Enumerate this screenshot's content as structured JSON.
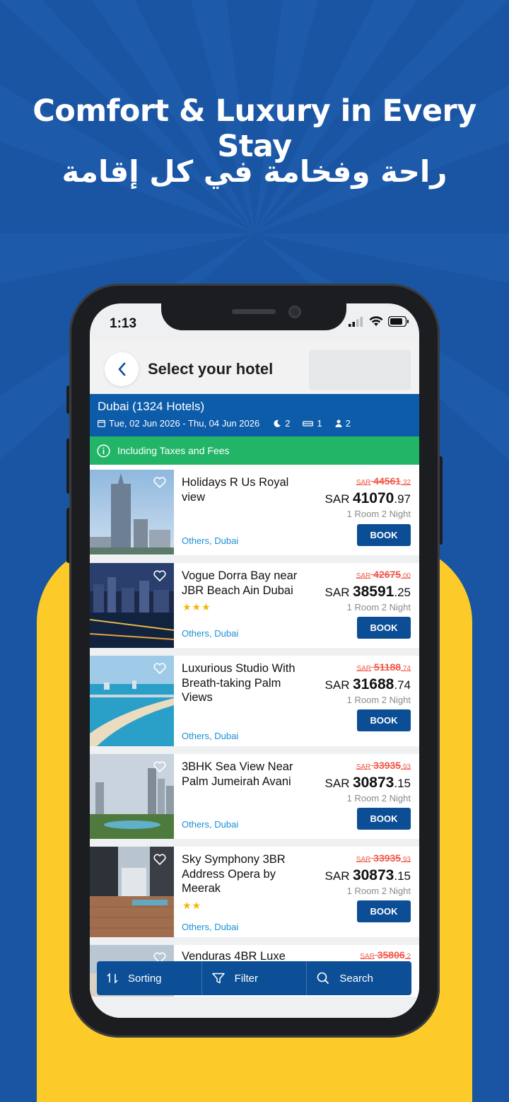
{
  "promo": {
    "title_en": "Comfort & Luxury in Every Stay",
    "title_ar": "راحة وفخامة في كل إقامة"
  },
  "colors": {
    "background": "#1a55a3",
    "accent_yellow": "#fccb29",
    "header_blue": "#0d5ca9",
    "green": "#22b568",
    "button_blue": "#0b4e96",
    "old_price_red": "#f2594a",
    "location_blue": "#1a8fd6"
  },
  "status": {
    "time": "1:13",
    "icons": [
      "signal-icon",
      "wifi-icon",
      "battery-icon"
    ]
  },
  "header": {
    "title": "Select your hotel",
    "back_icon": "chevron-left-icon"
  },
  "search_info": {
    "city": "Dubai (1324 Hotels)",
    "dates": "Tue, 02 Jun 2026 - Thu, 04 Jun 2026",
    "nights": "2",
    "rooms": "1",
    "guests": "2"
  },
  "notice": {
    "text": "Including Taxes and Fees"
  },
  "hotels": [
    {
      "name": "Holidays R Us Royal view",
      "stars": "",
      "location": "Others, Dubai",
      "old_price": "44561",
      "old_price_dec": ".32",
      "currency": "SAR",
      "price": "41070",
      "price_dec": ".97",
      "stay": "1 Room 2 Night",
      "book": "BOOK",
      "old_currency": "SAR"
    },
    {
      "name": "Vogue Dorra Bay near JBR Beach Ain Dubai",
      "stars": "★★★",
      "location": "Others, Dubai",
      "old_price": "42675",
      "old_price_dec": ".00",
      "currency": "SAR",
      "price": "38591",
      "price_dec": ".25",
      "stay": "1 Room 2 Night",
      "book": "BOOK",
      "old_currency": "SAR"
    },
    {
      "name": "Luxurious Studio With Breath-taking Palm Views",
      "stars": "",
      "location": "Others, Dubai",
      "old_price": "51188",
      "old_price_dec": ".74",
      "currency": "SAR",
      "price": "31688",
      "price_dec": ".74",
      "stay": "1 Room 2 Night",
      "book": "BOOK",
      "old_currency": "SAR"
    },
    {
      "name": "3BHK Sea View Near Palm Jumeirah Avani",
      "stars": "",
      "location": "Others, Dubai",
      "old_price": "33935",
      "old_price_dec": ".93",
      "currency": "SAR",
      "price": "30873",
      "price_dec": ".15",
      "stay": "1 Room 2 Night",
      "book": "BOOK",
      "old_currency": "SAR"
    },
    {
      "name": "Sky Symphony 3BR Address Opera by Meerak",
      "stars": "★★",
      "location": "Others, Dubai",
      "old_price": "33935",
      "old_price_dec": ".93",
      "currency": "SAR",
      "price": "30873",
      "price_dec": ".15",
      "stay": "1 Room 2 Night",
      "book": "BOOK",
      "old_currency": "SAR"
    },
    {
      "name": "Venduras 4BR Luxe",
      "stars": "",
      "location": "",
      "old_price": "35806",
      "old_price_dec": ".2",
      "currency": "",
      "price": "",
      "price_dec": "",
      "stay": "",
      "book": "",
      "old_currency": "SAR"
    }
  ],
  "bottom_bar": {
    "sorting": "Sorting",
    "filter": "Filter",
    "search": "Search"
  }
}
